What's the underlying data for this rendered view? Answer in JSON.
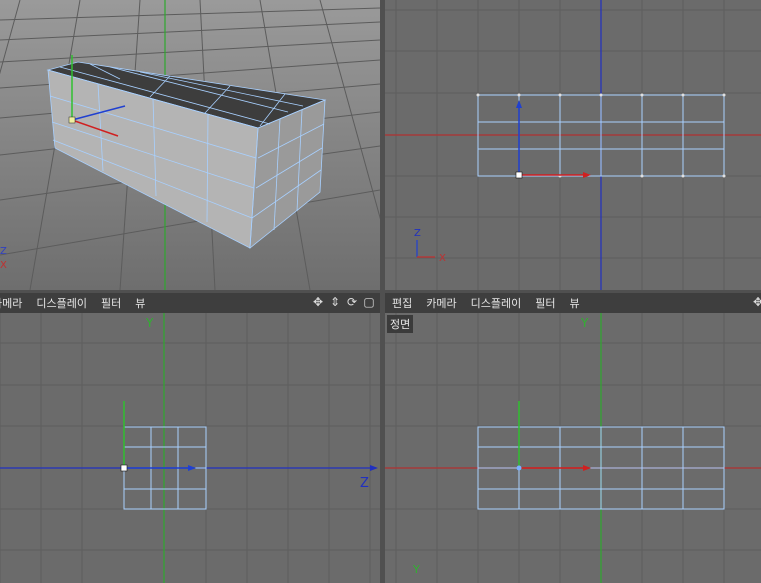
{
  "menus": {
    "bottom_left": [
      "카메라",
      "디스플레이",
      "필터",
      "뷰"
    ],
    "bottom_right": [
      "편집",
      "카메라",
      "디스플레이",
      "필터",
      "뷰"
    ]
  },
  "view_labels": {
    "front": "정면"
  },
  "axis_labels": {
    "z": "Z",
    "y": "Y",
    "x": "X"
  },
  "nav_icons": [
    "move-icon",
    "dolly-icon",
    "rotate-icon",
    "maximize-icon"
  ],
  "colors": {
    "viewport_bg": "#6b6b6b",
    "grid": "#5f5f5f",
    "menubar_bg": "#3e3e3e",
    "axis_x": "#c03030",
    "axis_y": "#30b030",
    "axis_z": "#2030c0",
    "wire": "#a8d0ff"
  }
}
